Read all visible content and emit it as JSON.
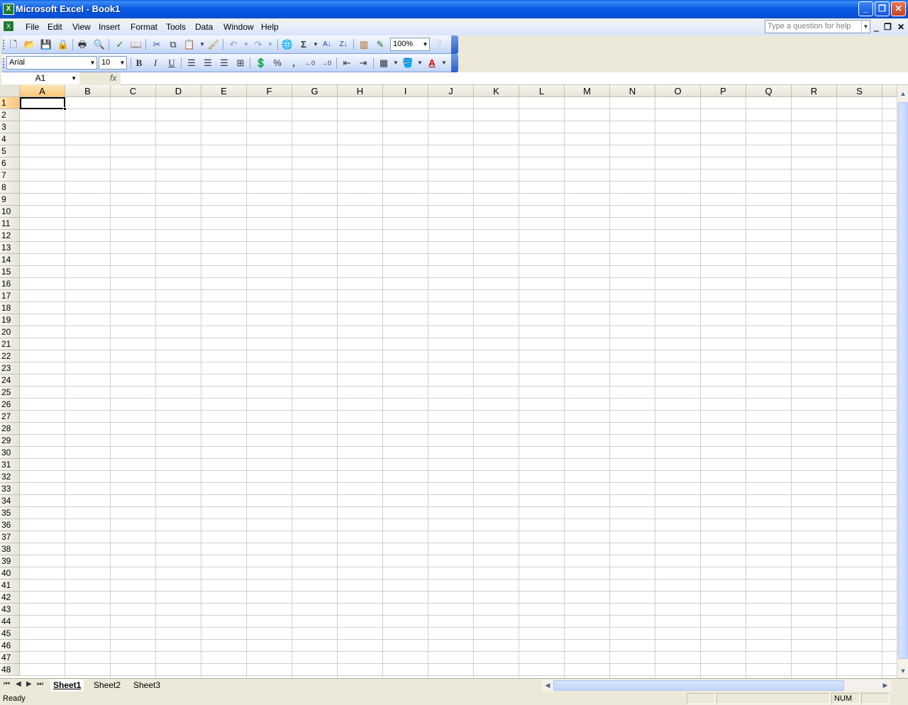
{
  "window": {
    "title": "Microsoft Excel - Book1",
    "minimize": "_",
    "restore": "❐",
    "close": "✕"
  },
  "menu": {
    "items": [
      "File",
      "Edit",
      "View",
      "Insert",
      "Format",
      "Tools",
      "Data",
      "Window",
      "Help"
    ],
    "help_placeholder": "Type a question for help",
    "mdi_min": "‗",
    "mdi_restore": "❐",
    "mdi_close": "✕"
  },
  "toolbar_standard": {
    "zoom": "100%"
  },
  "toolbar_formatting": {
    "font": "Arial",
    "size": "10",
    "bold": "B",
    "italic": "I",
    "underline": "U",
    "percent": "%",
    "comma": ","
  },
  "formula_bar": {
    "name_box": "A1",
    "fx": "fx",
    "content": ""
  },
  "grid": {
    "columns": [
      "A",
      "B",
      "C",
      "D",
      "E",
      "F",
      "G",
      "H",
      "I",
      "J",
      "K",
      "L",
      "M",
      "N",
      "O",
      "P",
      "Q",
      "R",
      "S"
    ],
    "rows": [
      "1",
      "2",
      "3",
      "4",
      "5",
      "6",
      "7",
      "8",
      "9",
      "10",
      "11",
      "12",
      "13",
      "14",
      "15",
      "16",
      "17",
      "18",
      "19",
      "20",
      "21",
      "22",
      "23",
      "24",
      "25",
      "26",
      "27",
      "28",
      "29",
      "30",
      "31",
      "32",
      "33",
      "34",
      "35",
      "36",
      "37",
      "38",
      "39",
      "40",
      "41",
      "42",
      "43",
      "44",
      "45",
      "46",
      "47",
      "48"
    ],
    "active_column": "A",
    "active_row": "1"
  },
  "sheets": {
    "tabs": [
      "Sheet1",
      "Sheet2",
      "Sheet3"
    ],
    "active": "Sheet1"
  },
  "status": {
    "text": "Ready",
    "num": "NUM"
  }
}
